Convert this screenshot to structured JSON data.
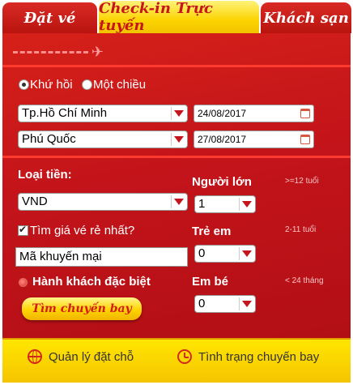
{
  "tabs": {
    "book": "Đặt vé",
    "checkin": "Check-in Trực tuyến",
    "hotel": "Khách sạn"
  },
  "trip_type": {
    "round_trip": "Khứ hồi",
    "one_way": "Một chiều",
    "selected": "round_trip"
  },
  "origin": {
    "value": "Tp.Hồ Chí Minh",
    "date": "24/08/2017"
  },
  "destination": {
    "value": "Phú Quốc",
    "date": "27/08/2017"
  },
  "currency": {
    "label": "Loại tiền:",
    "value": "VND"
  },
  "adults": {
    "label": "Người lớn",
    "hint": ">=12 tuổi",
    "value": "1"
  },
  "children": {
    "label": "Trẻ em",
    "hint": "2-11 tuổi",
    "value": "0"
  },
  "infants": {
    "label": "Em bé",
    "hint": "< 24 tháng",
    "value": "0"
  },
  "cheapest": {
    "label": "Tìm giá vé rẻ nhất?",
    "checked": true
  },
  "promo": {
    "value": "Mã khuyến mại"
  },
  "special_passenger": {
    "label": "Hành khách đặc biệt"
  },
  "search_button": "Tìm chuyến bay",
  "bottom_links": {
    "manage": "Quản lý đặt chỗ",
    "status": "Tình trạng chuyến bay"
  },
  "icons": {
    "plane": "plane-icon",
    "calendar": "calendar-icon",
    "globe": "globe-icon",
    "clock": "clock-icon"
  },
  "colors": {
    "panel_red": "#c3141a",
    "tab_yellow": "#fbd400",
    "bottom_yellow": "#ffe600",
    "accent_text_red": "#c4161c"
  }
}
